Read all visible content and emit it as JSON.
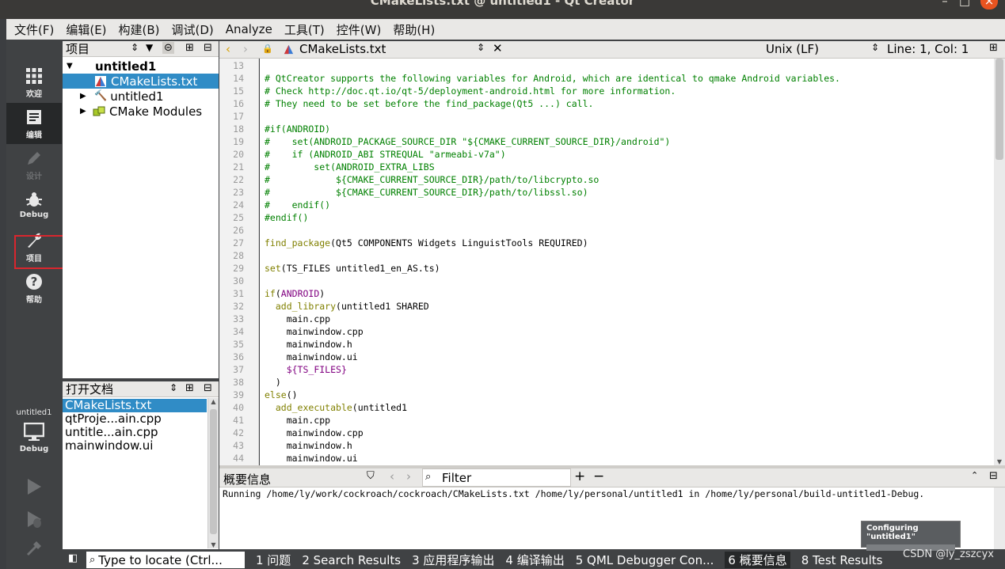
{
  "window": {
    "title": "CMakeLists.txt @ untitled1 - Qt Creator"
  },
  "menu": [
    "文件(F)",
    "编辑(E)",
    "构建(B)",
    "调试(D)",
    "Analyze",
    "工具(T)",
    "控件(W)",
    "帮助(H)"
  ],
  "modes": [
    {
      "label": "欢迎",
      "icon": "grid-icon",
      "state": "normal"
    },
    {
      "label": "编辑",
      "icon": "document-edit-icon",
      "state": "active"
    },
    {
      "label": "设计",
      "icon": "pencil-icon",
      "state": "disabled"
    },
    {
      "label": "Debug",
      "icon": "bug-icon",
      "state": "normal"
    },
    {
      "label": "项目",
      "icon": "wrench-icon",
      "state": "normal"
    },
    {
      "label": "帮助",
      "icon": "help-icon",
      "state": "normal"
    }
  ],
  "kit": {
    "project": "untitled1",
    "build": "Debug"
  },
  "project_panel": {
    "title": "项目",
    "tree": [
      {
        "label": "untitled1",
        "depth": 0,
        "expanded": true,
        "icon": "project-icon"
      },
      {
        "label": "CMakeLists.txt",
        "depth": 1,
        "selected": true,
        "icon": "cmake-file-icon"
      },
      {
        "label": "untitled1",
        "depth": 1,
        "expanded": false,
        "icon": "hammer-icon"
      },
      {
        "label": "CMake Modules",
        "depth": 1,
        "expanded": false,
        "icon": "modules-icon"
      }
    ]
  },
  "open_docs": {
    "title": "打开文档",
    "items": [
      "CMakeLists.txt",
      "qtProje...ain.cpp",
      "untitle...ain.cpp",
      "mainwindow.ui"
    ]
  },
  "editor": {
    "filename": "CMakeLists.txt",
    "line_ending": "Unix (LF)",
    "position": "Line: 1, Col: 1",
    "lines": [
      {
        "n": "13",
        "t": ""
      },
      {
        "n": "14",
        "t": "# QtCreator supports the following variables for Android, which are identical to qmake Android variables."
      },
      {
        "n": "15",
        "t": "# Check http://doc.qt.io/qt-5/deployment-android.html for more information."
      },
      {
        "n": "16",
        "t": "# They need to be set before the find_package(Qt5 ...) call."
      },
      {
        "n": "17",
        "t": ""
      },
      {
        "n": "18",
        "t": "#if(ANDROID)"
      },
      {
        "n": "19",
        "t": "#    set(ANDROID_PACKAGE_SOURCE_DIR \"${CMAKE_CURRENT_SOURCE_DIR}/android\")"
      },
      {
        "n": "20",
        "t": "#    if (ANDROID_ABI STREQUAL \"armeabi-v7a\")"
      },
      {
        "n": "21",
        "t": "#        set(ANDROID_EXTRA_LIBS"
      },
      {
        "n": "22",
        "t": "#            ${CMAKE_CURRENT_SOURCE_DIR}/path/to/libcrypto.so"
      },
      {
        "n": "23",
        "t": "#            ${CMAKE_CURRENT_SOURCE_DIR}/path/to/libssl.so)"
      },
      {
        "n": "24",
        "t": "#    endif()"
      },
      {
        "n": "25",
        "t": "#endif()"
      },
      {
        "n": "26",
        "t": ""
      },
      {
        "n": "27",
        "t": "find_package(Qt5 COMPONENTS Widgets LinguistTools REQUIRED)"
      },
      {
        "n": "28",
        "t": ""
      },
      {
        "n": "29",
        "t": "set(TS_FILES untitled1_en_AS.ts)"
      },
      {
        "n": "30",
        "t": ""
      },
      {
        "n": "31",
        "t": "if(ANDROID)"
      },
      {
        "n": "32",
        "t": "  add_library(untitled1 SHARED"
      },
      {
        "n": "33",
        "t": "    main.cpp"
      },
      {
        "n": "34",
        "t": "    mainwindow.cpp"
      },
      {
        "n": "35",
        "t": "    mainwindow.h"
      },
      {
        "n": "36",
        "t": "    mainwindow.ui"
      },
      {
        "n": "37",
        "t": "    ${TS_FILES}"
      },
      {
        "n": "38",
        "t": "  )"
      },
      {
        "n": "39",
        "t": "else()"
      },
      {
        "n": "40",
        "t": "  add_executable(untitled1"
      },
      {
        "n": "41",
        "t": "    main.cpp"
      },
      {
        "n": "42",
        "t": "    mainwindow.cpp"
      },
      {
        "n": "43",
        "t": "    mainwindow.h"
      },
      {
        "n": "44",
        "t": "    mainwindow.ui"
      }
    ]
  },
  "output_pane": {
    "title": "概要信息",
    "filter_placeholder": "Filter",
    "text": "Running /home/ly/work/cockroach/cockroach/CMakeLists.txt /home/ly/personal/untitled1 in /home/ly/personal/build-untitled1-Debug."
  },
  "progress": {
    "label": "Configuring \"untitled1\""
  },
  "statusbar": {
    "locator_placeholder": "Type to locate (Ctrl...",
    "buttons": [
      "1 问题",
      "2 Search Results",
      "3 应用程序输出",
      "4 编译输出",
      "5 QML Debugger Con...",
      "6 概要信息",
      "8 Test Results"
    ],
    "active_index": 5
  },
  "watermark": "CSDN @ly_zszcyx"
}
